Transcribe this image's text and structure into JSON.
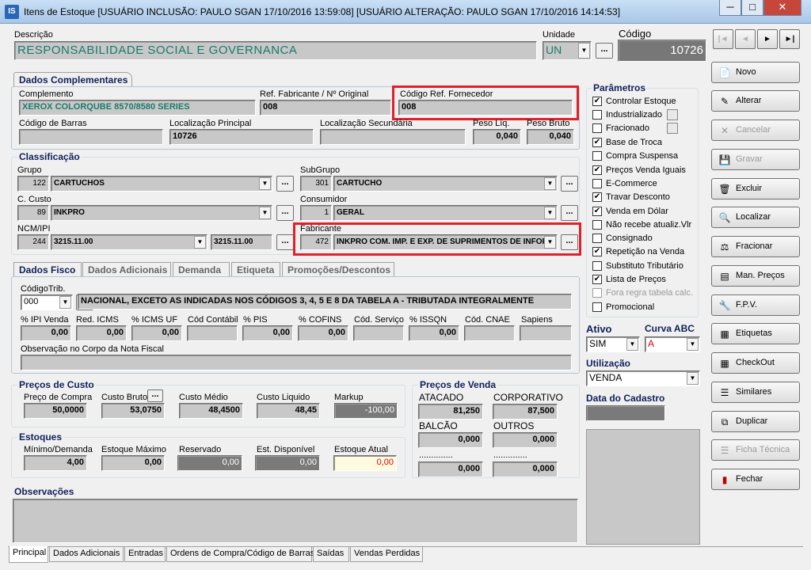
{
  "window": {
    "app_icon": "IS",
    "title": "Itens de Estoque  [USUÁRIO INCLUSÃO: PAULO SGAN 17/10/2016 13:59:08]  [USUÁRIO ALTERAÇÃO: PAULO SGAN 17/10/2016 14:14:53]",
    "minimize": "─",
    "maximize": "□",
    "close": "✕"
  },
  "header": {
    "descricao_label": "Descrição",
    "descricao_value": "RESPONSABILIDADE SOCIAL E GOVERNANCA",
    "unidade_label": "Unidade",
    "unidade_value": "UN",
    "codigo_label": "Código",
    "codigo_value": "10726",
    "dots": "..."
  },
  "nav": {
    "first": "|◄",
    "prev": "◄",
    "next": "►",
    "last": "►|"
  },
  "dados_complementares": {
    "tab_label": "Dados Complementares",
    "complemento_label": "Complemento",
    "complemento_value": "XEROX COLORQUBE 8570/8580 SERIES",
    "ref_fabricante_label": "Ref. Fabricante / Nº Original",
    "ref_fabricante_value": "008",
    "codigo_ref_fornecedor_label": "Código Ref. Fornecedor",
    "codigo_ref_fornecedor_value": "008",
    "codigo_barras_label": "Código de Barras",
    "codigo_barras_value": "",
    "localizacao_principal_label": "Localização Principal",
    "localizacao_principal_value": "10726",
    "localizacao_secundaria_label": "Localização Secundária",
    "localizacao_secundaria_value": "",
    "peso_liq_label": "Peso Líq.",
    "peso_liq_value": "0,040",
    "peso_bruto_label": "Peso Bruto",
    "peso_bruto_value": "0,040"
  },
  "classificacao": {
    "title": "Classificação",
    "grupo_label": "Grupo",
    "grupo_code": "122",
    "grupo_value": "CARTUCHOS",
    "subgrupo_label": "SubGrupo",
    "subgrupo_code": "301",
    "subgrupo_value": "CARTUCHO",
    "ccusto_label": "C. Custo",
    "ccusto_code": "89",
    "ccusto_value": "INKPRO",
    "consumidor_label": "Consumidor",
    "consumidor_code": "1",
    "consumidor_value": "GERAL",
    "ncm_label": "NCM/IPI",
    "ncm_code": "244",
    "ncm_value": "3215.11.00",
    "ncm_value2": "3215.11.00",
    "fabricante_label": "Fabricante",
    "fabricante_code": "472",
    "fabricante_value": "INKPRO COM. IMP. E EXP. DE SUPRIMENTOS DE INFORM"
  },
  "tabs": [
    "Dados Fisco",
    "Dados Adicionais",
    "Demanda",
    "Etiqueta",
    "Promoções/Descontos"
  ],
  "fisco": {
    "codigo_trib_label": "CódigoTrib.",
    "codigo_trib_value": "000",
    "codigo_trib_desc": "NACIONAL, EXCETO AS INDICADAS NOS CÓDIGOS 3, 4, 5 E 8 DA TABELA A - TRIBUTADA INTEGRALMENTE",
    "ipi_venda_label": "% IPI Venda",
    "ipi_venda_value": "0,00",
    "red_icms_label": "Red. ICMS",
    "red_icms_value": "0,00",
    "icms_uf_label": "% ICMS UF",
    "icms_uf_value": "0,00",
    "cod_contabil_label": "Cód Contábil",
    "cod_contabil_value": "",
    "pis_label": "% PIS",
    "pis_value": "0,00",
    "cofins_label": "% COFINS",
    "cofins_value": "0,00",
    "cod_servico_label": "Cód. Serviço",
    "cod_servico_value": "",
    "issqn_label": "% ISSQN",
    "issqn_value": "0,00",
    "cod_cnae_label": "Cód. CNAE",
    "cod_cnae_value": "",
    "sapiens_label": "Sapiens",
    "sapiens_value": "",
    "obs_nota_label": "Observação no Corpo da Nota Fiscal",
    "obs_nota_value": ""
  },
  "precos_custo": {
    "title": "Preços de Custo",
    "preco_compra_label": "Preço de Compra",
    "preco_compra_value": "50,0000",
    "custo_bruto_label": "Custo Bruto",
    "custo_bruto_value": "53,0750",
    "custo_medio_label": "Custo Médio",
    "custo_medio_value": "48,4500",
    "custo_liquido_label": "Custo Liquido",
    "custo_liquido_value": "48,45",
    "markup_label": "Markup",
    "markup_value": "-100,00"
  },
  "estoques": {
    "title": "Estoques",
    "minimo_label": "Mínimo/Demanda",
    "minimo_value": "4,00",
    "maximo_label": "Estoque Máximo",
    "maximo_value": "0,00",
    "reservado_label": "Reservado",
    "reservado_value": "0,00",
    "disponivel_label": "Est. Disponível",
    "disponivel_value": "0,00",
    "atual_label": "Estoque Atual",
    "atual_value": "0,00"
  },
  "precos_venda": {
    "title": "Preços de Venda",
    "atacado_label": "ATACADO",
    "atacado_value": "81,250",
    "corporativo_label": "CORPORATIVO",
    "corporativo_value": "87,500",
    "balcao_label": "BALCÃO",
    "balcao_value": "0,000",
    "outros_label": "OUTROS",
    "outros_value": "0,000",
    "extra1_label": "..............",
    "extra1_value": "0,000",
    "extra2_label": "..............",
    "extra2_value": "0,000"
  },
  "observacoes": {
    "label": "Observações",
    "value": ""
  },
  "parametros": {
    "title": "Parâmetros",
    "items": [
      {
        "label": "Controlar Estoque",
        "checked": "✔"
      },
      {
        "label": "Industrializado",
        "checked": ""
      },
      {
        "label": "Fracionado",
        "checked": ""
      },
      {
        "label": "Base de Troca",
        "checked": "✔"
      },
      {
        "label": "Compra Suspensa",
        "checked": ""
      },
      {
        "label": "Preços Venda Iguais",
        "checked": "✔"
      },
      {
        "label": "E-Commerce",
        "checked": ""
      },
      {
        "label": "Travar Desconto",
        "checked": "✔"
      },
      {
        "label": "Venda em Dólar",
        "checked": "✔"
      },
      {
        "label": "Não recebe atualiz.Vlr",
        "checked": ""
      },
      {
        "label": "Consignado",
        "checked": ""
      },
      {
        "label": "Repetição na Venda",
        "checked": "✔"
      },
      {
        "label": "Substituto Tributário",
        "checked": ""
      },
      {
        "label": "Lista de Preços",
        "checked": "✔"
      },
      {
        "label": "Fora regra tabela calc.",
        "checked": ""
      },
      {
        "label": "Promocional",
        "checked": ""
      }
    ]
  },
  "status": {
    "ativo_label": "Ativo",
    "ativo_value": "SIM",
    "curva_label": "Curva ABC",
    "curva_value": "A",
    "utilizacao_label": "Utilização",
    "utilizacao_value": "VENDA",
    "data_cadastro_label": "Data do Cadastro",
    "data_cadastro_value": ""
  },
  "actions": [
    {
      "label": "Novo",
      "icon": "📄"
    },
    {
      "label": "Alterar",
      "icon": "✎"
    },
    {
      "label": "Cancelar",
      "icon": "✕"
    },
    {
      "label": "Gravar",
      "icon": "💾"
    },
    {
      "label": "Excluir",
      "icon": "🗑"
    },
    {
      "label": "Localizar",
      "icon": "🔍"
    },
    {
      "label": "Fracionar",
      "icon": "⚖"
    },
    {
      "label": "Man. Preços",
      "icon": "▤"
    },
    {
      "label": "F.P.V.",
      "icon": "🔧"
    },
    {
      "label": "Etiquetas",
      "icon": "▦"
    },
    {
      "label": "CheckOut",
      "icon": "▦"
    },
    {
      "label": "Similares",
      "icon": "☰"
    },
    {
      "label": "Duplicar",
      "icon": "⧉"
    },
    {
      "label": "Ficha Técnica",
      "icon": "☰"
    },
    {
      "label": "Fechar",
      "icon": "▮"
    }
  ],
  "bottom_tabs": [
    "Principal",
    "Dados Adicionais",
    "Entradas",
    "Ordens de Compra/Código de Barras",
    "Saídas",
    "Vendas Perdidas"
  ]
}
